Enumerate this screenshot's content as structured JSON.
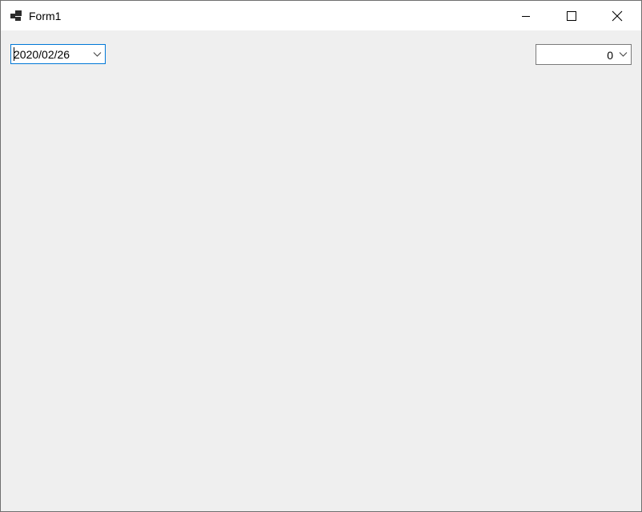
{
  "window": {
    "title": "Form1"
  },
  "controls": {
    "date_picker": {
      "value": "2020/02/26",
      "icon": "chevron-down-icon"
    },
    "numeric_combo": {
      "value": "0",
      "icon": "chevron-down-icon"
    }
  },
  "colors": {
    "client_background": "#efefef",
    "titlebar_background": "#ffffff",
    "focus_border": "#0078d7",
    "border": "#7a7a7a"
  }
}
